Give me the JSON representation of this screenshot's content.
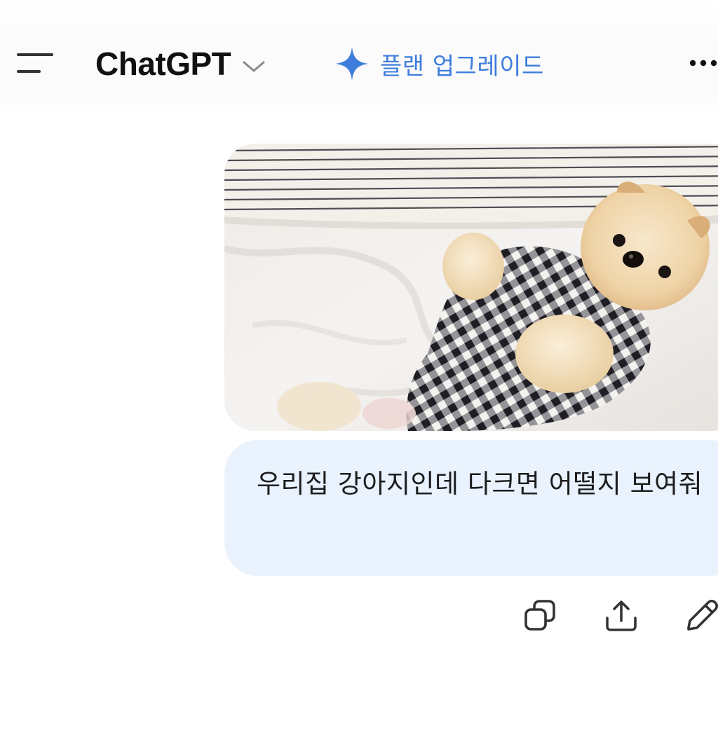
{
  "header": {
    "title": "ChatGPT",
    "upgrade_label": "플랜 업그레이드",
    "icons": {
      "menu": "menu-icon",
      "title_dropdown": "chevron-down-icon",
      "upgrade": "sparkle-icon",
      "more": "more-horizontal-icon"
    }
  },
  "message": {
    "text": "우리집 강아지인데 다크면 어떨지 보여줘",
    "attachment": "photo-of-pomeranian-in-gingham-shirt-on-bed"
  },
  "actions": {
    "icons": [
      "copy-icon",
      "share-icon",
      "edit-icon"
    ]
  },
  "colors": {
    "accent": "#3f7ddb",
    "user_bubble": "#e9f2fd",
    "text": "#1d1d1f"
  }
}
